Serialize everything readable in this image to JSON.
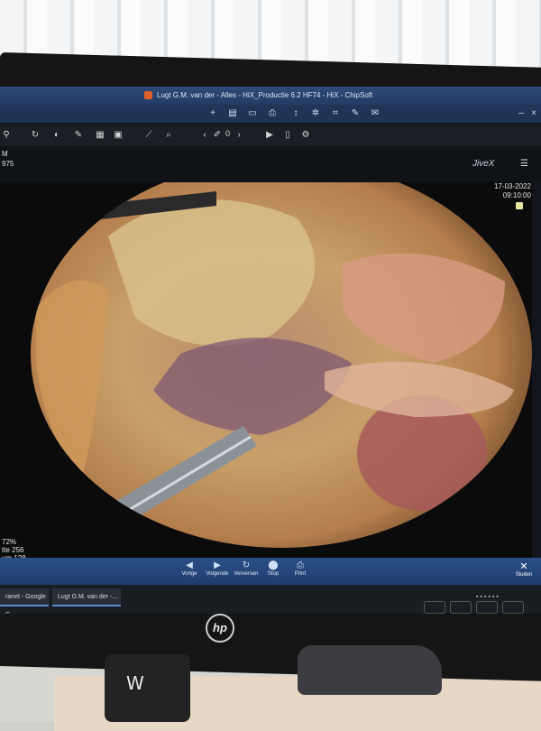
{
  "window": {
    "title": "Lugt G.M. van der - Alles - HiX_Productie 6.2 HF74 - HiX - ChipSoft"
  },
  "toolbar": {
    "image_counter": "0"
  },
  "patient": {
    "line1": "M",
    "line2": "975"
  },
  "brand": {
    "viewer": "JiveX"
  },
  "viewer": {
    "date": "17-03-2022",
    "time": "09:10:00",
    "zoom": "72%",
    "stat_label_1": "tte 256",
    "stat_label_2": "um 128"
  },
  "nav": {
    "prev": "Vorige",
    "next": "Volgende",
    "refresh": "Verversen",
    "stop": "Stop",
    "print": "Print",
    "close": "Sluiten"
  },
  "taskbar": {
    "item1": "ranet - Google C...",
    "item2": "Lugt G.M. van der -..."
  },
  "hardware": {
    "monitor_logo": "hp",
    "stand_logo": "W"
  },
  "icons": {
    "prev": "arrow-left-icon",
    "next": "arrow-right-icon",
    "refresh": "refresh-icon",
    "stop": "stop-icon",
    "print": "printer-icon",
    "close": "close-icon"
  }
}
